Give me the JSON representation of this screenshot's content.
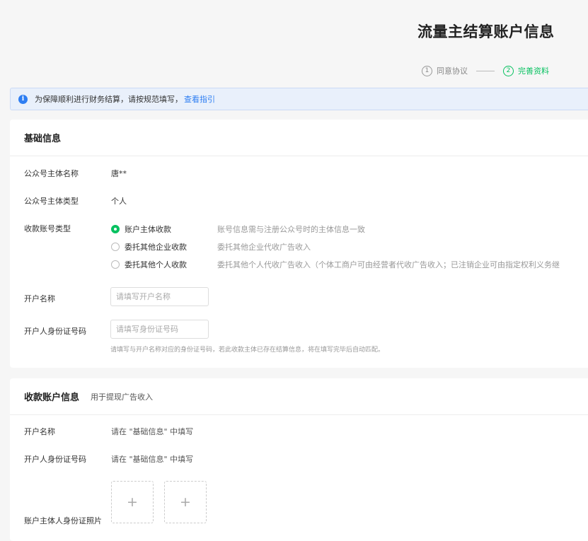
{
  "page": {
    "title": "流量主结算账户信息"
  },
  "steps": [
    {
      "num": "1",
      "label": "同意协议",
      "state": "done"
    },
    {
      "num": "2",
      "label": "完善资料",
      "state": "active"
    }
  ],
  "notice": {
    "icon": "info-icon",
    "text": "为保障顺利进行财务结算，请按规范填写，",
    "link": "查看指引"
  },
  "basic": {
    "title": "基础信息",
    "entity_name_label": "公众号主体名称",
    "entity_name_value": "唐**",
    "entity_type_label": "公众号主体类型",
    "entity_type_value": "个人",
    "account_type_label": "收款账号类型",
    "options": [
      {
        "label": "账户主体收款",
        "desc": "账号信息需与注册公众号时的主体信息一致",
        "checked": true
      },
      {
        "label": "委托其他企业收款",
        "desc": "委托其他企业代收广告收入",
        "checked": false
      },
      {
        "label": "委托其他个人收款",
        "desc": "委托其他个人代收广告收入（个体工商户可由经营者代收广告收入；已注销企业可由指定权利义务继",
        "checked": false
      }
    ],
    "account_name_label": "开户名称",
    "account_name_placeholder": "请填写开户名称",
    "id_label": "开户人身份证号码",
    "id_placeholder": "请填写身份证号码",
    "id_hint": "请填写与开户名称对应的身份证号码，若此收款主体已存在结算信息，将在填写完毕后自动匹配。"
  },
  "receive": {
    "title": "收款账户信息",
    "subtitle": "用于提现广告收入",
    "account_name_label": "开户名称",
    "account_name_value": "请在 \"基础信息\" 中填写",
    "id_label": "开户人身份证号码",
    "id_value": "请在 \"基础信息\" 中填写",
    "photo_label": "账户主体人身份证照片",
    "upload_symbol": "+"
  },
  "colors": {
    "accent": "#07c160",
    "link": "#2e7ef2",
    "notice_bg": "#e9f0fb"
  }
}
